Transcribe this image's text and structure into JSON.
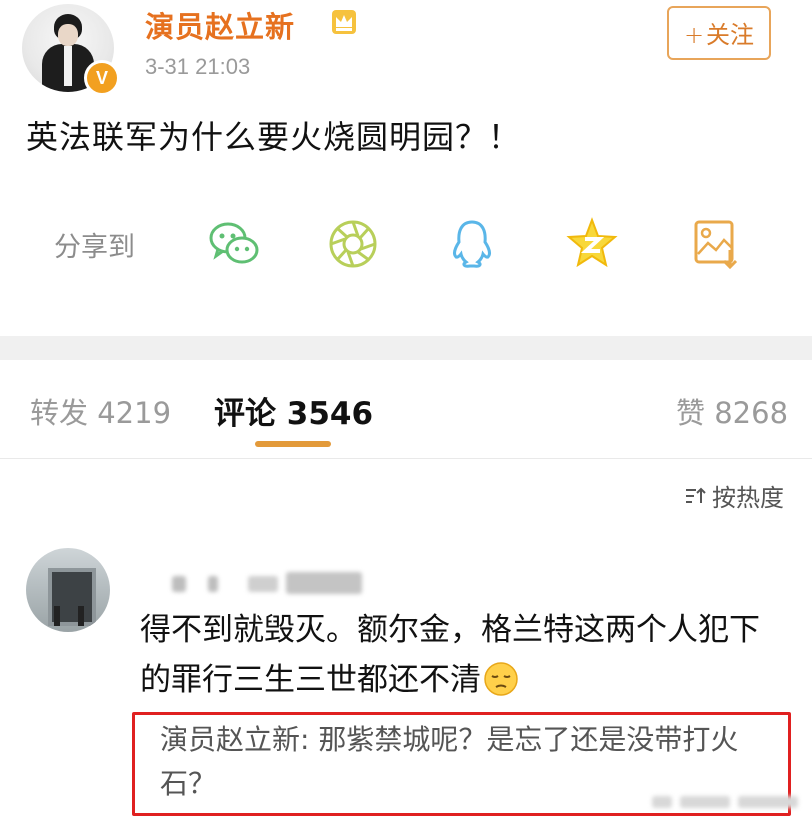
{
  "post": {
    "author": "演员赵立新",
    "timestamp": "3-31 21:03",
    "follow_label": "关注",
    "follow_plus": "+",
    "text": "英法联军为什么要火烧圆明园？！"
  },
  "share": {
    "label": "分享到",
    "icons": [
      "wechat-icon",
      "moments-icon",
      "qq-icon",
      "qzone-icon",
      "save-image-icon"
    ]
  },
  "tabs": {
    "repost": "转发 4219",
    "comment": "评论 3546",
    "likes": "赞 8268"
  },
  "sort": {
    "icon": "sort-icon",
    "label": "按热度"
  },
  "comment": {
    "text": "得不到就毁灭。额尔金，格兰特这两个人犯下的罪行三生三世都还不清",
    "emoji": "pensive-face-emoji",
    "reply_author": "演员赵立新:",
    "reply_text": " 那紫禁城呢？是忘了还是没带打火石？"
  },
  "colors": {
    "accent": "#e6711f",
    "reply_box": "#e02020",
    "tab_underline": "#e39a3a"
  }
}
